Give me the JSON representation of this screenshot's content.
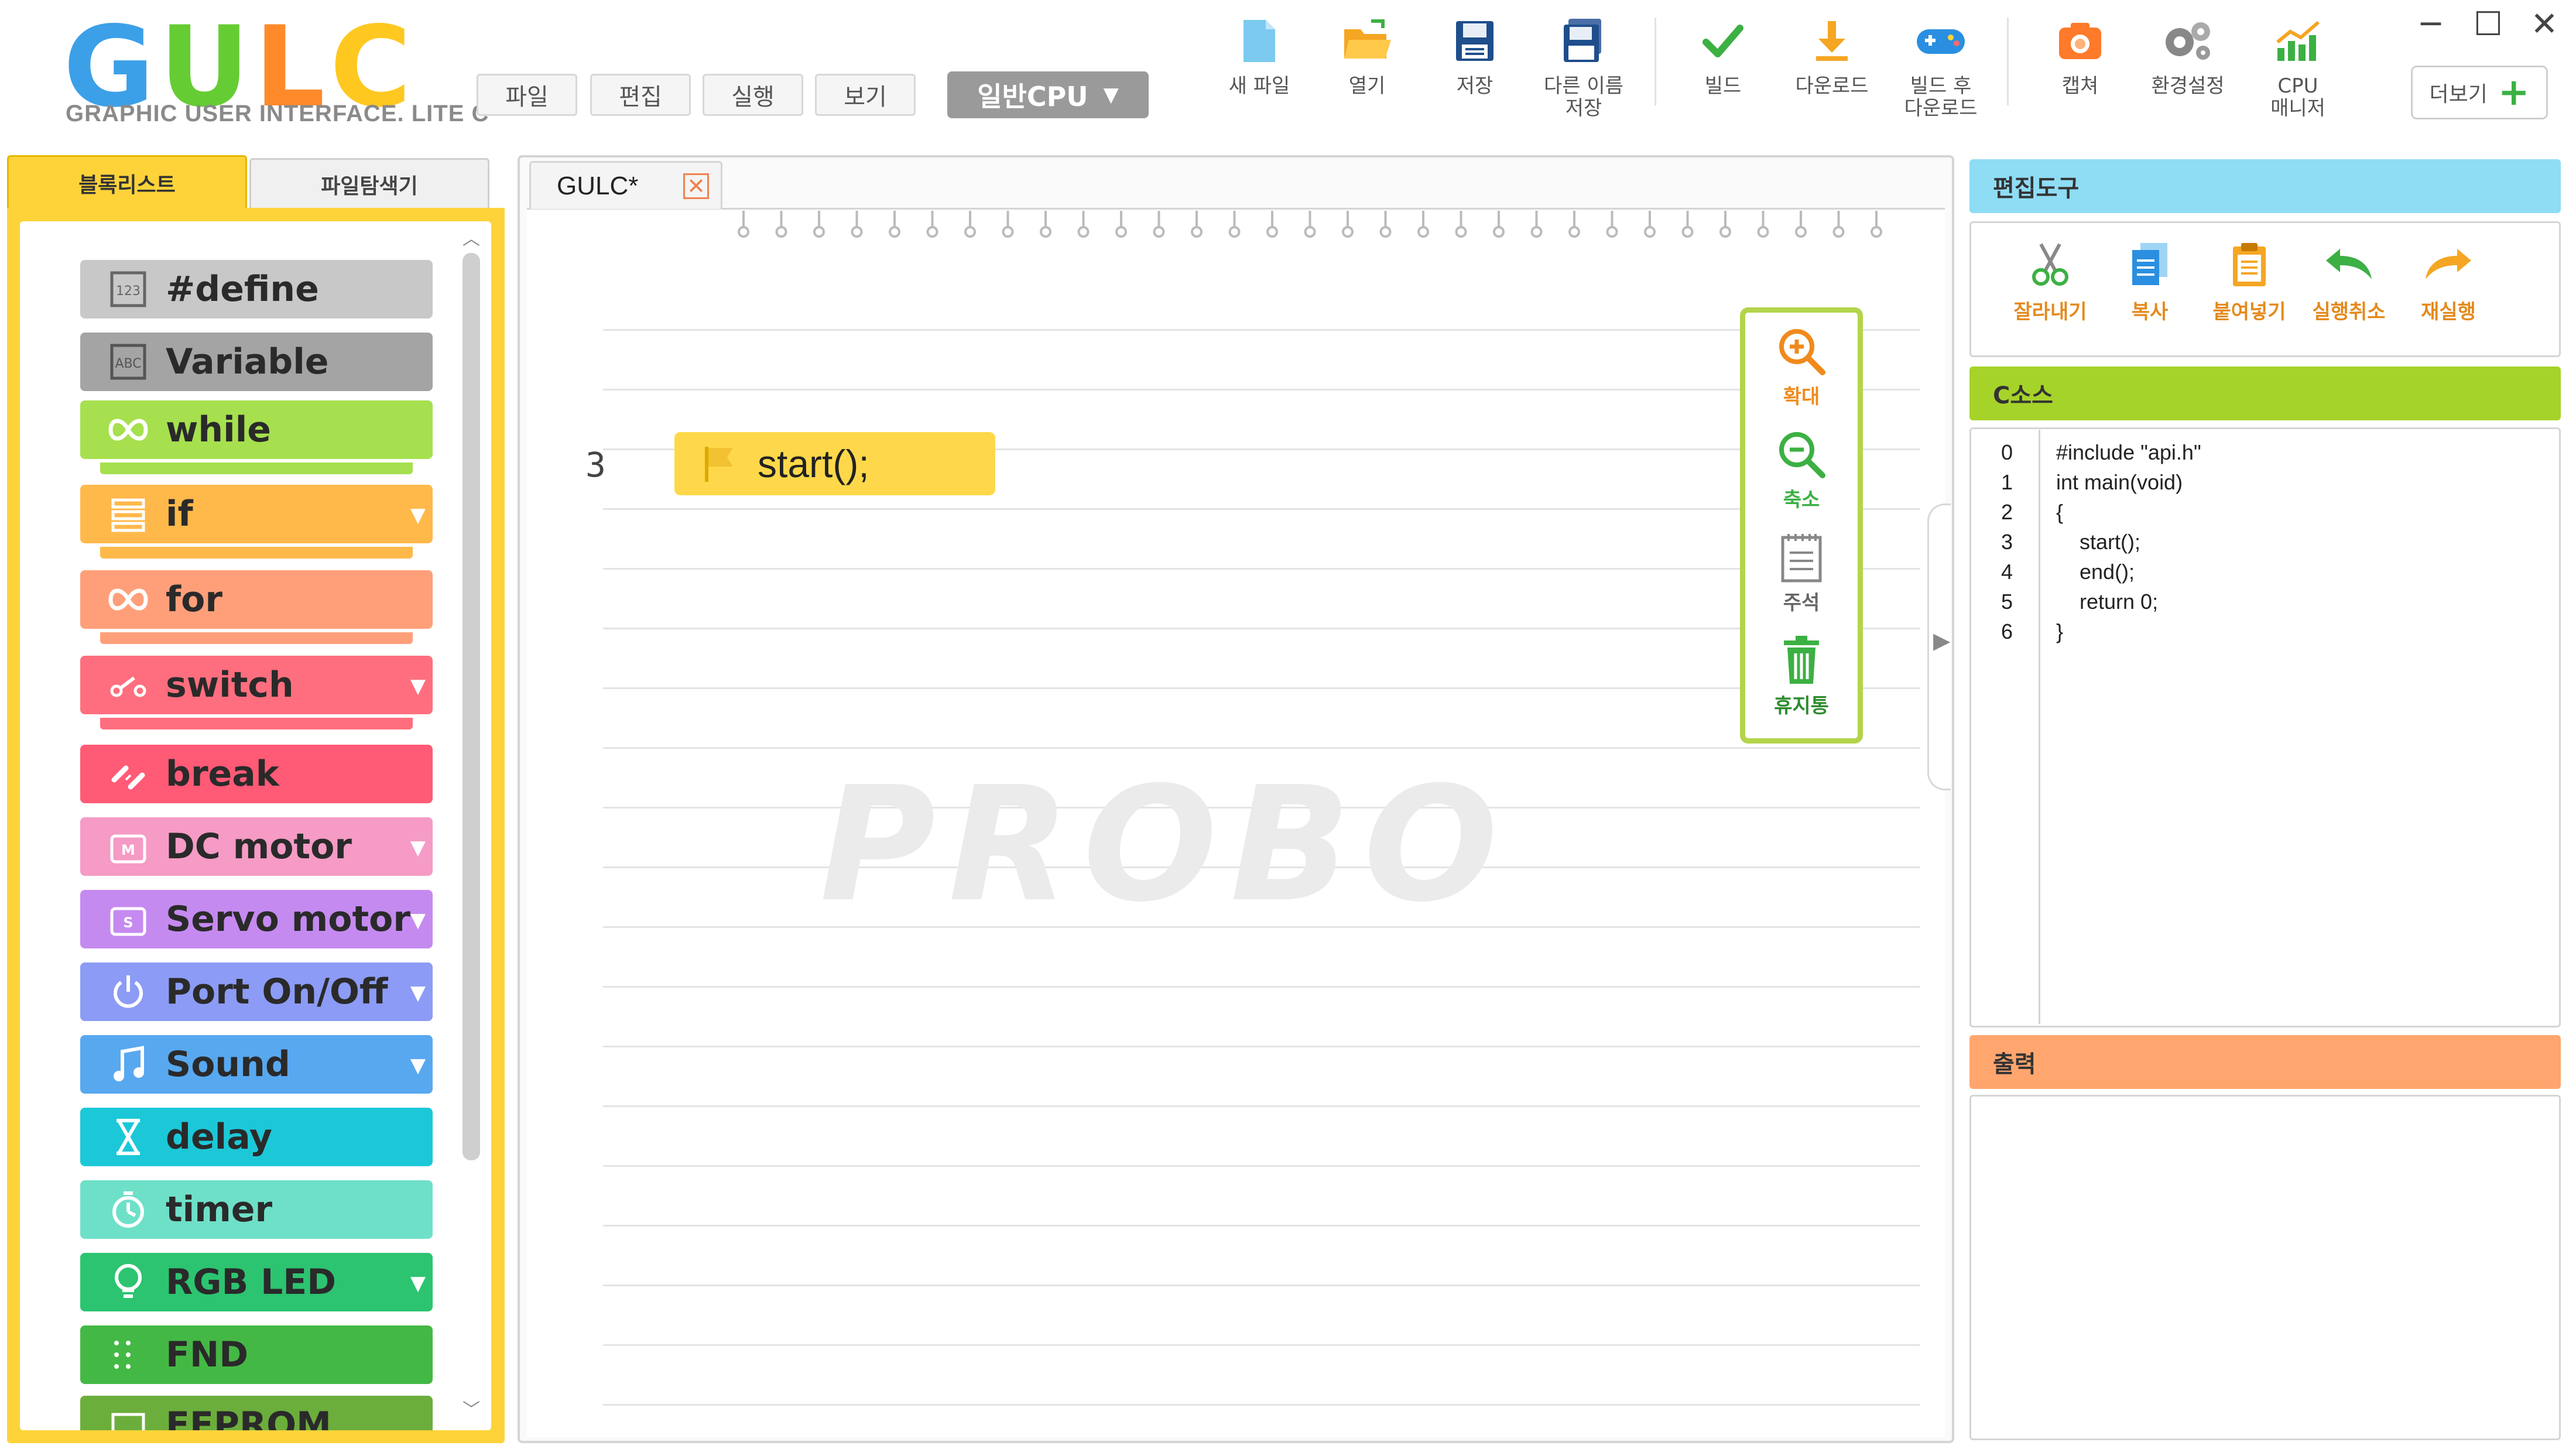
{
  "app": {
    "logo": "GULC",
    "logo_subtitle": "GRAPHIC USER INTERFACE. LITE C"
  },
  "menu": [
    {
      "label": "파일"
    },
    {
      "label": "편집"
    },
    {
      "label": "실행"
    },
    {
      "label": "보기"
    }
  ],
  "cpu_select": {
    "value": "일반CPU"
  },
  "toolbar": {
    "new_file": "새 파일",
    "open": "열기",
    "save": "저장",
    "save_as": "다른 이름\n저장",
    "build": "빌드",
    "download": "다운로드",
    "build_download": "빌드 후\n다운로드",
    "capture": "캡쳐",
    "settings": "환경설정",
    "cpu_manager": "CPU\n매니저",
    "more": "더보기"
  },
  "left_tabs": {
    "blocks": "블록리스트",
    "explorer": "파일탐색기"
  },
  "blocks": [
    {
      "label": "#define",
      "color": "#c8c8c8",
      "lip": "#c8c8c8",
      "dropdown": false,
      "icon": "define-icon"
    },
    {
      "label": "Variable",
      "color": "#a4a4a4",
      "lip": "#a4a4a4",
      "dropdown": false,
      "icon": "variable-icon"
    },
    {
      "label": "while",
      "color": "#a6e04e",
      "lip": "#a6e04e",
      "dropdown": false,
      "icon": "loop-icon"
    },
    {
      "label": "if",
      "color": "#ffb84a",
      "lip": "#ffb84a",
      "dropdown": true,
      "icon": "branch-icon"
    },
    {
      "label": "for",
      "color": "#ff9f7a",
      "lip": "#ff9f7a",
      "dropdown": false,
      "icon": "loop-icon"
    },
    {
      "label": "switch",
      "color": "#ff6e7e",
      "lip": "#ff6e7e",
      "dropdown": true,
      "icon": "switch-icon"
    },
    {
      "label": "break",
      "color": "#ff5a76",
      "lip": "#ff5a76",
      "dropdown": false,
      "icon": "break-icon"
    },
    {
      "label": "DC motor",
      "color": "#f59bc5",
      "lip": "#f59bc5",
      "dropdown": true,
      "icon": "motor-icon"
    },
    {
      "label": "Servo motor",
      "color": "#c58af0",
      "lip": "#c58af0",
      "dropdown": true,
      "icon": "servo-icon"
    },
    {
      "label": "Port On/Off",
      "color": "#8c9bf5",
      "lip": "#8c9bf5",
      "dropdown": true,
      "icon": "power-icon"
    },
    {
      "label": "Sound",
      "color": "#58a8f0",
      "lip": "#58a8f0",
      "dropdown": true,
      "icon": "music-icon"
    },
    {
      "label": "delay",
      "color": "#1cc8d8",
      "lip": "#1cc8d8",
      "dropdown": false,
      "icon": "hourglass-icon"
    },
    {
      "label": "timer",
      "color": "#6ee0c8",
      "lip": "#6ee0c8",
      "dropdown": false,
      "icon": "timer-icon"
    },
    {
      "label": "RGB LED",
      "color": "#2cc470",
      "lip": "#2cc470",
      "dropdown": true,
      "icon": "bulb-icon"
    },
    {
      "label": "FND",
      "color": "#44b844",
      "lip": "#44b844",
      "dropdown": false,
      "icon": "fnd-icon"
    },
    {
      "label": "EEPROM",
      "color": "#6cae3c",
      "lip": "#6cae3c",
      "dropdown": false,
      "icon": "eeprom-icon"
    }
  ],
  "editor": {
    "tab_title": "GULC*",
    "line_number": "3",
    "block_text": "start();",
    "watermark": "PROBO"
  },
  "zoom_panel": {
    "zoom_in": "확대",
    "zoom_out": "축소",
    "comment": "주석",
    "trash": "휴지통"
  },
  "edit_tools": {
    "header": "편집도구",
    "cut": "잘라내기",
    "copy": "복사",
    "paste": "붙여넣기",
    "undo": "실행취소",
    "redo": "재실행"
  },
  "c_source": {
    "header": "C소스",
    "lines": [
      {
        "no": "0",
        "text": "#include \"api.h\""
      },
      {
        "no": "1",
        "text": "int main(void)"
      },
      {
        "no": "2",
        "text": "{"
      },
      {
        "no": "3",
        "text": "    start();"
      },
      {
        "no": "4",
        "text": "    end();"
      },
      {
        "no": "5",
        "text": "    return 0;"
      },
      {
        "no": "6",
        "text": "}"
      }
    ]
  },
  "output": {
    "header": "출력"
  },
  "colors": {
    "accent_yellow": "#fed33a",
    "edit_tools_header": "#8fdcf5",
    "c_source_header": "#a6d32a",
    "output_header": "#ffa66e",
    "zoom_border": "#b3d44a"
  }
}
